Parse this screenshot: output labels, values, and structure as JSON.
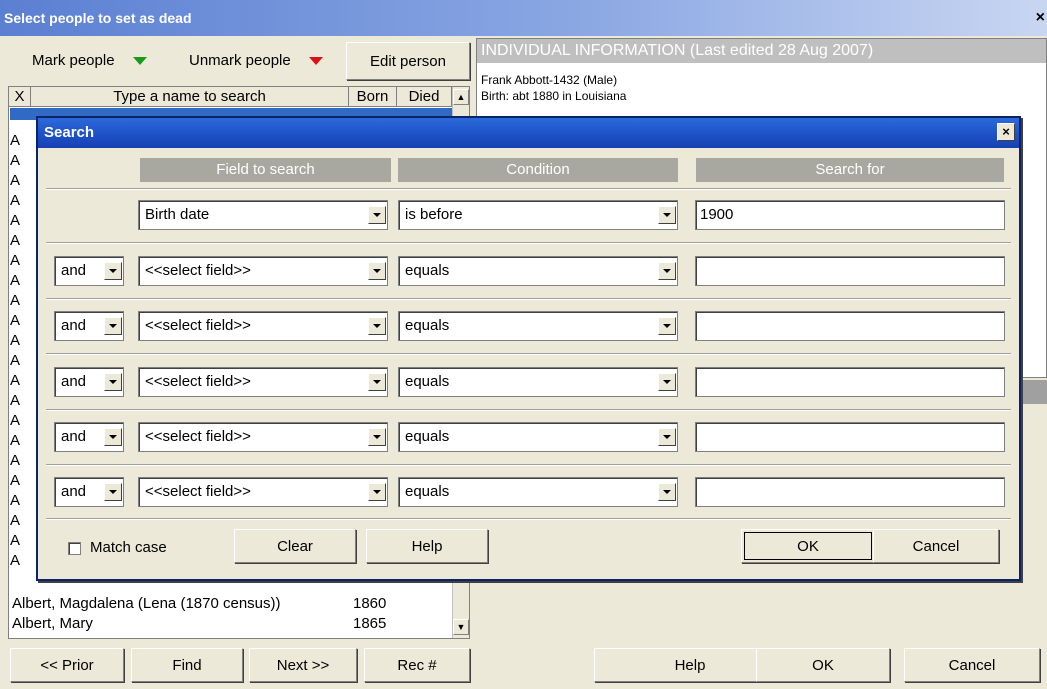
{
  "window": {
    "title": "Select people to set as dead",
    "close": "×"
  },
  "toolbar": {
    "mark": "Mark people",
    "unmark": "Unmark people",
    "edit": "Edit person",
    "mark_color": "#1a9a1a",
    "unmark_color": "#dd1111"
  },
  "list": {
    "header_x": "X",
    "header_name": "Type a name to search",
    "header_born": "Born",
    "header_died": "Died",
    "row_prefix": "A",
    "rows": [
      {
        "name": "Albert, Magdalena (Lena (1870 census))",
        "born": "1860",
        "died": ""
      },
      {
        "name": "Albert, Mary",
        "born": "1865",
        "died": ""
      }
    ]
  },
  "info": {
    "title": "INDIVIDUAL INFORMATION  (Last edited 28 Aug 2007)",
    "lines": [
      "Frank Abbott-1432 (Male)",
      "Birth: abt 1880 in Louisiana"
    ]
  },
  "bottom": {
    "prior": "<< Prior",
    "find": "Find",
    "next": "Next >>",
    "rec": "Rec #",
    "help": "Help",
    "ok": "OK",
    "cancel": "Cancel"
  },
  "search": {
    "title": "Search",
    "close": "×",
    "col_field": "Field to search",
    "col_condition": "Condition",
    "col_search_for": "Search for",
    "first": {
      "field": "Birth date",
      "condition": "is before",
      "value": "1900"
    },
    "rows": [
      {
        "op": "and",
        "field": "<<select field>>",
        "condition": "equals",
        "value": ""
      },
      {
        "op": "and",
        "field": "<<select field>>",
        "condition": "equals",
        "value": ""
      },
      {
        "op": "and",
        "field": "<<select field>>",
        "condition": "equals",
        "value": ""
      },
      {
        "op": "and",
        "field": "<<select field>>",
        "condition": "equals",
        "value": ""
      },
      {
        "op": "and",
        "field": "<<select field>>",
        "condition": "equals",
        "value": ""
      }
    ],
    "match_case": "Match case",
    "clear": "Clear",
    "help": "Help",
    "ok": "OK",
    "cancel": "Cancel"
  }
}
